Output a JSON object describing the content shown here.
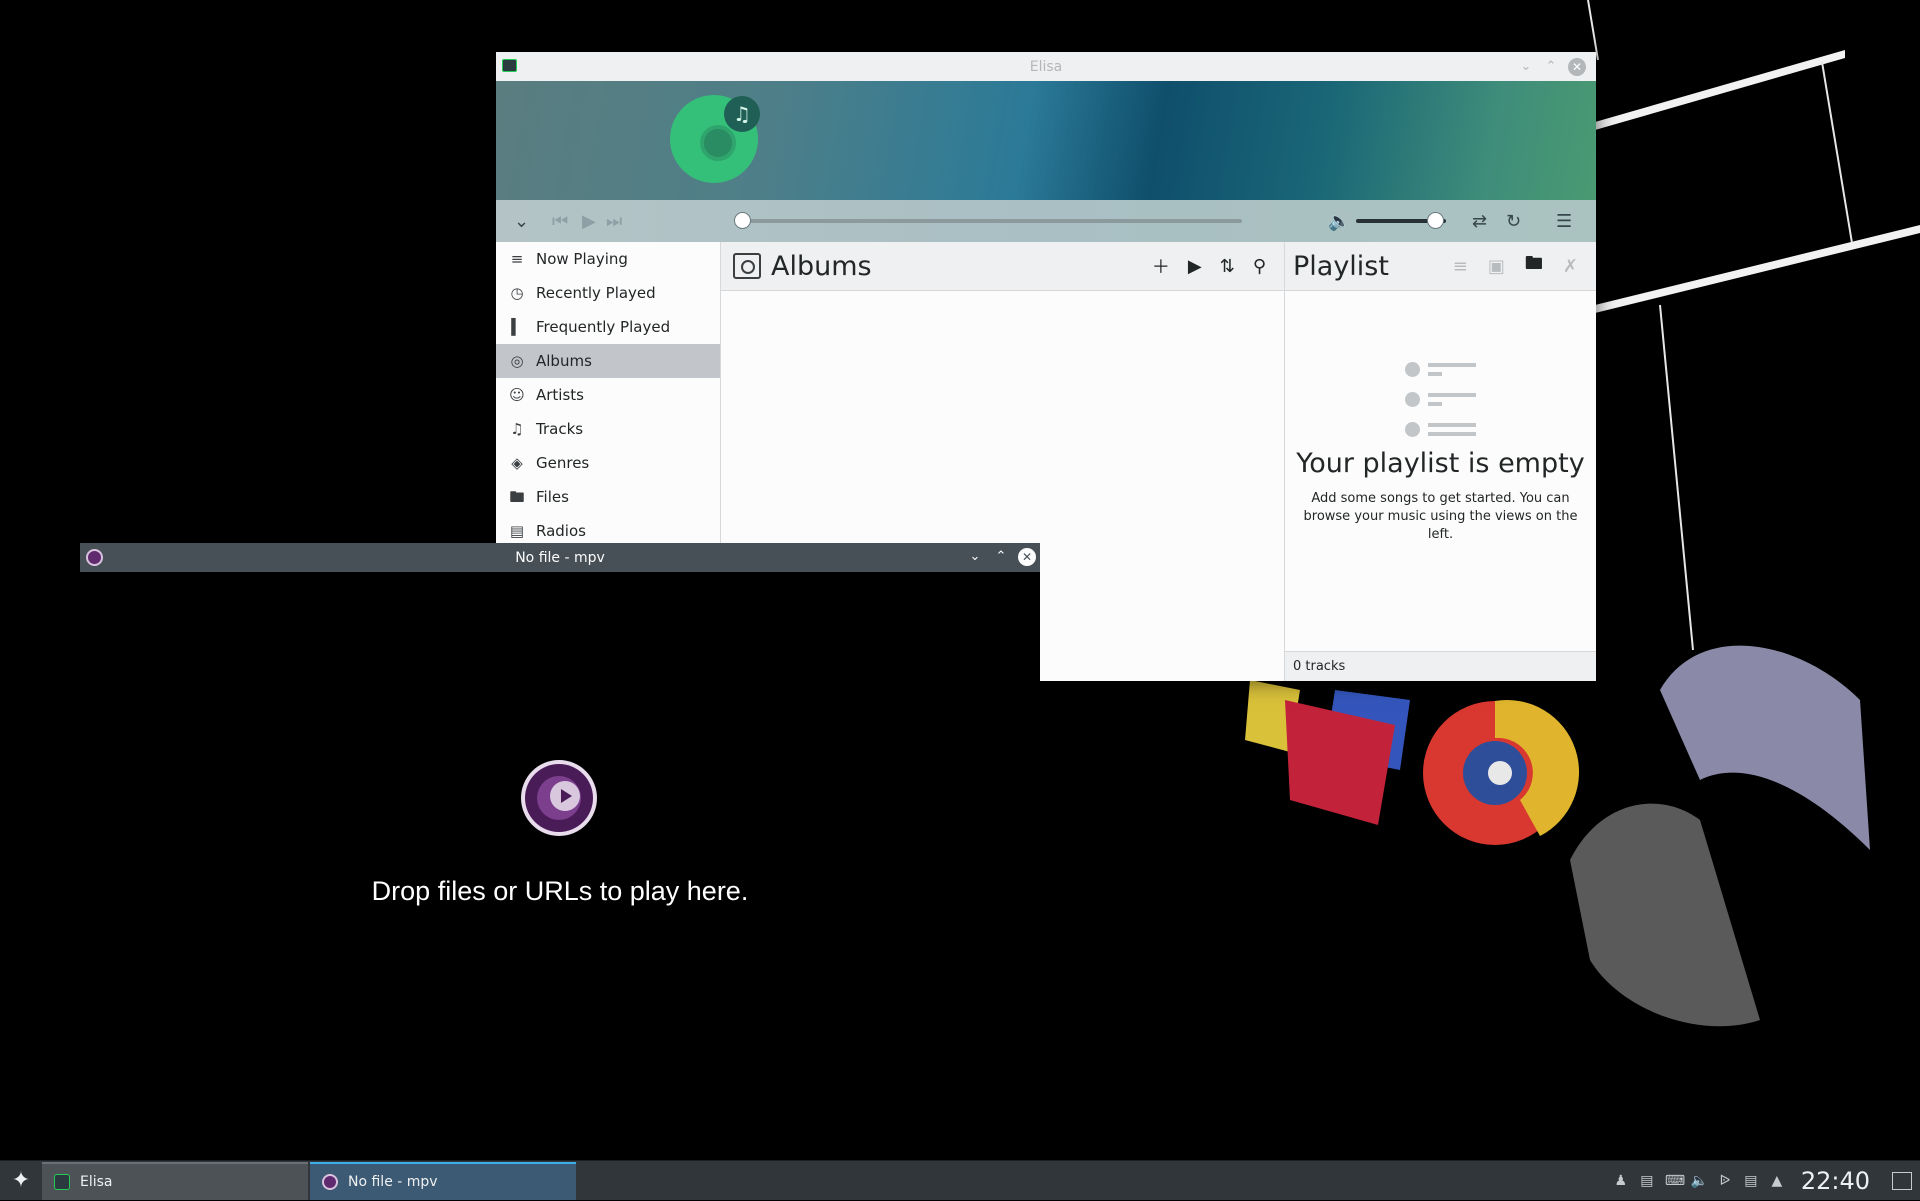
{
  "elisa": {
    "title": "Elisa",
    "nav": [
      {
        "label": "Now Playing",
        "icon": "now-playing-icon"
      },
      {
        "label": "Recently Played",
        "icon": "recent-icon"
      },
      {
        "label": "Frequently Played",
        "icon": "frequent-icon"
      },
      {
        "label": "Albums",
        "icon": "album-icon",
        "active": true
      },
      {
        "label": "Artists",
        "icon": "artist-icon"
      },
      {
        "label": "Tracks",
        "icon": "track-icon"
      },
      {
        "label": "Genres",
        "icon": "genre-icon"
      },
      {
        "label": "Files",
        "icon": "folder-icon"
      },
      {
        "label": "Radios",
        "icon": "radio-icon"
      }
    ],
    "albums_title": "Albums",
    "playlist_title": "Playlist",
    "playlist_empty_title": "Your playlist is empty",
    "playlist_empty_subtitle": "Add some songs to get started. You can browse your music using the views on the left.",
    "track_count": "0 tracks",
    "volume_level": 0.88,
    "seek_position": 0.0
  },
  "mpv": {
    "title": "No file - mpv",
    "drop_text": "Drop files or URLs to play here."
  },
  "taskbar": {
    "tasks": [
      {
        "label": "Elisa"
      },
      {
        "label": "No file - mpv"
      }
    ],
    "clock": "22:40"
  },
  "colors": {
    "accent": "#3daee9",
    "taskbar": "#31363b",
    "mpv_purple": "#4a1c57"
  }
}
